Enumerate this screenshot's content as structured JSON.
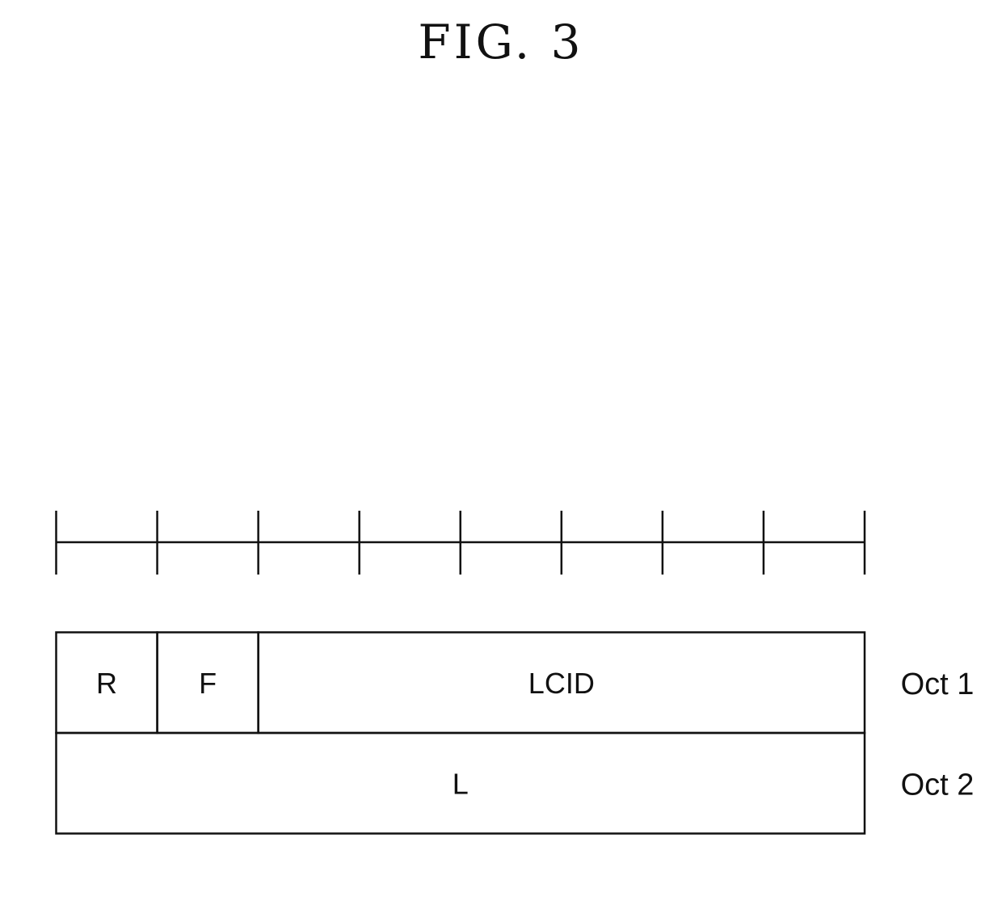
{
  "figure": {
    "title": "FIG. 3"
  },
  "ruler": {
    "bits_per_octet": 8
  },
  "octets": [
    {
      "label": "Oct 1",
      "fields": [
        {
          "name": "R",
          "bits": 1
        },
        {
          "name": "F",
          "bits": 1
        },
        {
          "name": "LCID",
          "bits": 6
        }
      ]
    },
    {
      "label": "Oct 2",
      "fields": [
        {
          "name": "L",
          "bits": 8
        }
      ]
    }
  ]
}
